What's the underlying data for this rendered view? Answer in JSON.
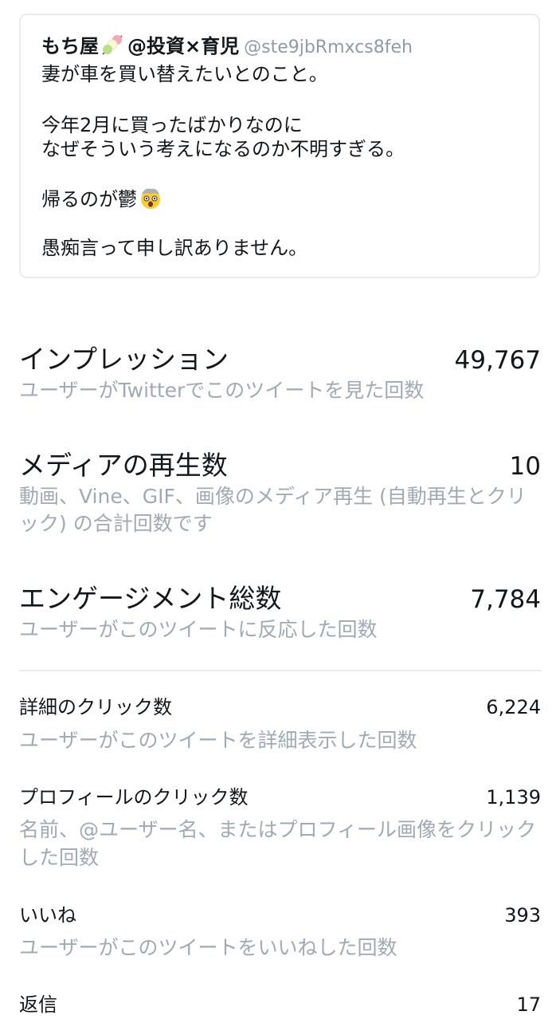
{
  "tweet": {
    "author_name": "もち屋",
    "author_suffix": "@投資×育児",
    "author_handle": "@ste9jbRmxcs8feh",
    "lines": [
      "妻が車を買い替えたいとのこと。",
      "今年2月に買ったばかりなのに",
      "なぜそういう考えになるのか不明すぎる。",
      "帰るのが鬱",
      "愚痴言って申し訳ありません。"
    ],
    "icons": {
      "name_icon": "dango-icon",
      "line_icon": "exploding-head-emoji-icon"
    }
  },
  "metrics": {
    "impressions": {
      "title": "インプレッション",
      "value": "49,767",
      "desc": "ユーザーがTwitterでこのツイートを見た回数"
    },
    "media_views": {
      "title": "メディアの再生数",
      "value": "10",
      "desc": "動画、Vine、GIF、画像のメディア再生 (自動再生とクリック) の合計回数です"
    },
    "engagements": {
      "title": "エンゲージメント総数",
      "value": "7,784",
      "desc": "ユーザーがこのツイートに反応した回数"
    }
  },
  "details": {
    "detail_clicks": {
      "title": "詳細のクリック数",
      "value": "6,224",
      "desc": "ユーザーがこのツイートを詳細表示した回数"
    },
    "profile_clicks": {
      "title": "プロフィールのクリック数",
      "value": "1,139",
      "desc": "名前、@ユーザー名、またはプロフィール画像をクリックした回数"
    },
    "likes": {
      "title": "いいね",
      "value": "393",
      "desc": "ユーザーがこのツイートをいいねした回数"
    },
    "replies": {
      "title": "返信",
      "value": "17"
    }
  },
  "colors": {
    "text": "#14171a",
    "secondary_text": "#a0aab4",
    "handle": "#8f9ba6",
    "border": "#e6ecf0"
  }
}
